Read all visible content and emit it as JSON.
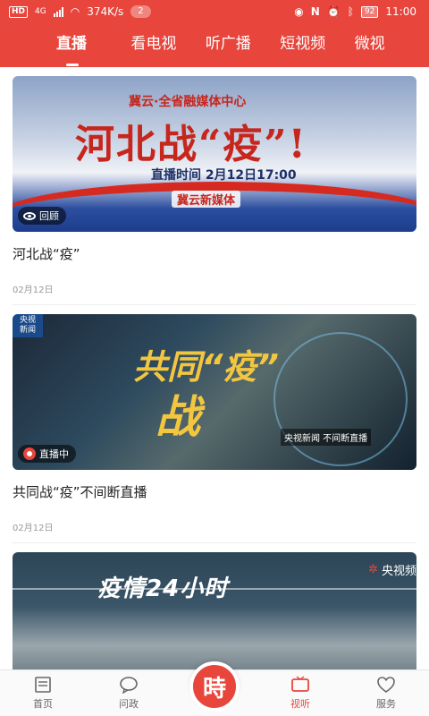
{
  "status_bar": {
    "hd": "HD",
    "network": "4G",
    "speed": "374K/s",
    "notif_count": "2",
    "battery": "92",
    "time": "11:00"
  },
  "tabs": [
    {
      "label": "直播",
      "active": true
    },
    {
      "label": "看电视",
      "active": false
    },
    {
      "label": "听广播",
      "active": false
    },
    {
      "label": "短视频",
      "active": false
    },
    {
      "label": "微视",
      "active": false
    }
  ],
  "cards": [
    {
      "title": "河北战“疫”",
      "date": "02月12日",
      "badge": "回顾",
      "thumb": {
        "top_line": "冀云·全省融媒体中心",
        "headline": "河北战“疫”!",
        "time": "直播时间 2月12日17:00",
        "logo": "冀云新媒体"
      }
    },
    {
      "title": "共同战“疫”不间断直播",
      "date": "02月12日",
      "badge": "直播中",
      "thumb": {
        "corner_tag": "央视新闻",
        "line1": "共同“疫”",
        "line2": "战",
        "sub": "央视新闻 不间断直播"
      }
    },
    {
      "thumb": {
        "headline": "疫情24小时",
        "brand": "央视频"
      }
    }
  ],
  "bottom_nav": [
    {
      "label": "首页",
      "icon": "newspaper-icon",
      "active": false
    },
    {
      "label": "问政",
      "icon": "chat-bubble-icon",
      "active": false
    },
    {
      "label": "",
      "icon": "center-logo",
      "active": false
    },
    {
      "label": "视听",
      "icon": "tv-icon",
      "active": true
    },
    {
      "label": "服务",
      "icon": "heart-icon",
      "active": false
    }
  ],
  "center_glyph": "時",
  "colors": {
    "brand": "#e8453c",
    "text": "#222222",
    "muted": "#999999"
  }
}
